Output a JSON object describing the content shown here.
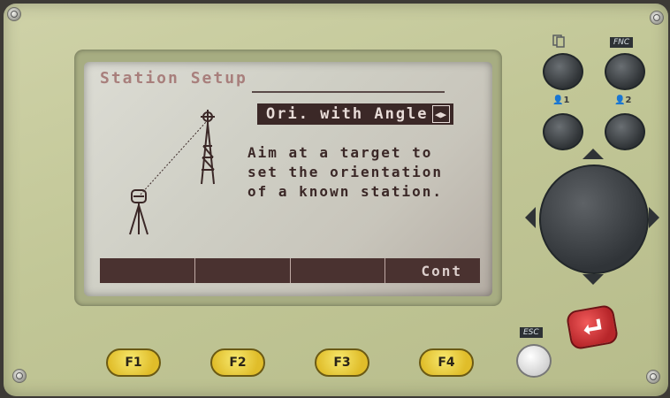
{
  "screen": {
    "title": "Station Setup",
    "mode_selector": "Ori. with Angle",
    "message_lines": [
      "Aim at a target to",
      "set the orientation",
      "of a known station."
    ],
    "softkeys": [
      "",
      "",
      "",
      "Cont"
    ]
  },
  "hardware": {
    "fnc_label": "FNC",
    "user1_label": "1",
    "user2_label": "2",
    "esc_label": "ESC",
    "fkeys": [
      "F1",
      "F2",
      "F3",
      "F4"
    ]
  },
  "colors": {
    "body": "#c2c797",
    "lcd": "#d2d2c9",
    "highlight": "#3b2827",
    "fkey": "#e8c93a",
    "enter": "#c8262a"
  },
  "icons": {
    "page": "page-icon",
    "user": "user-icon",
    "enter": "enter-icon",
    "mode": "left-right-arrows-icon"
  }
}
